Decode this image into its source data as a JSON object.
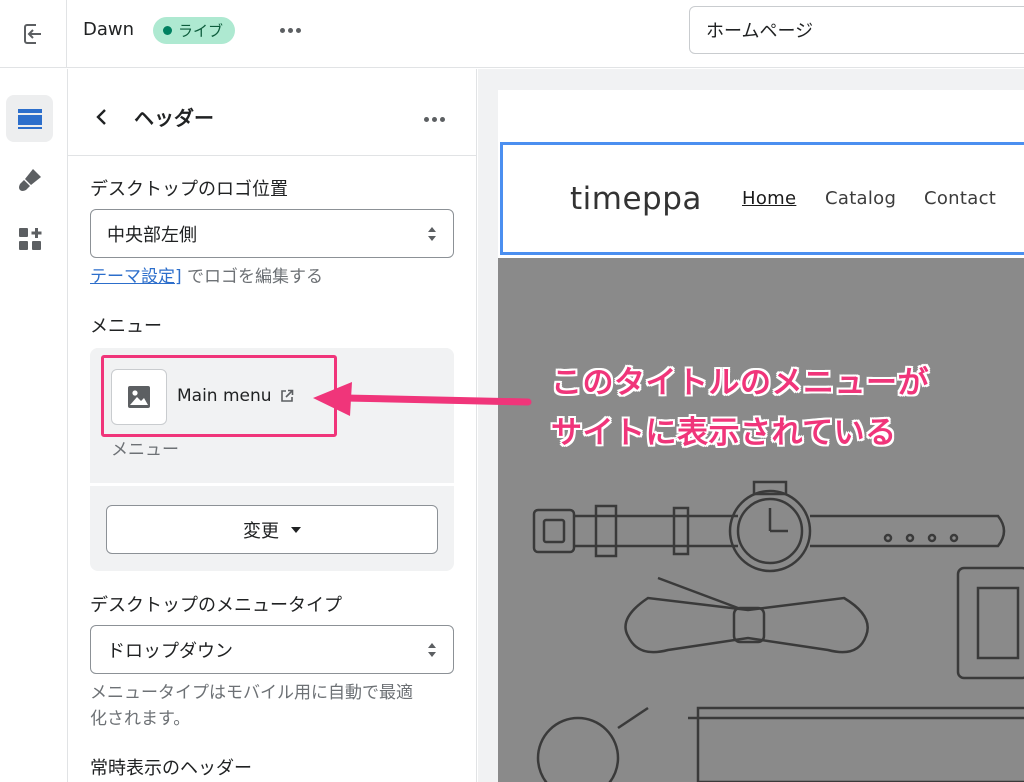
{
  "topbar": {
    "theme_name": "Dawn",
    "status_badge": "ライブ",
    "page_select_value": "ホームページ"
  },
  "panel": {
    "title": "ヘッダー",
    "logo_position": {
      "label": "デスクトップのロゴ位置",
      "value": "中央部左側",
      "help_link": "テーマ設定]",
      "help_text": " でロゴを編集する"
    },
    "menu": {
      "label": "メニュー",
      "selected_name": "Main menu",
      "selected_sub": "メニュー",
      "change_button": "変更"
    },
    "menu_type": {
      "label": "デスクトップのメニュータイプ",
      "value": "ドロップダウン",
      "help_line1": "メニュータイプはモバイル用に自動で最適",
      "help_line2": "化されます。"
    },
    "sticky_header": {
      "label": "常時表示のヘッダー"
    }
  },
  "preview": {
    "site_logo": "timeppa",
    "nav": [
      "Home",
      "Catalog",
      "Contact"
    ]
  },
  "annotation": {
    "line1": "このタイトルのメニューが",
    "line2": "サイトに表示されている",
    "color": "#f0357a"
  },
  "colors": {
    "live_badge_bg": "#aee9d1",
    "link": "#2c6ecb",
    "preview_selection": "#4b8ff0",
    "hero_bg": "#8a8a8a"
  },
  "icons": [
    "exit-icon",
    "sections-icon",
    "theme-settings-icon",
    "apps-icon",
    "back-chevron-icon",
    "more-icon",
    "image-icon",
    "external-link-icon",
    "select-arrows-icon"
  ]
}
